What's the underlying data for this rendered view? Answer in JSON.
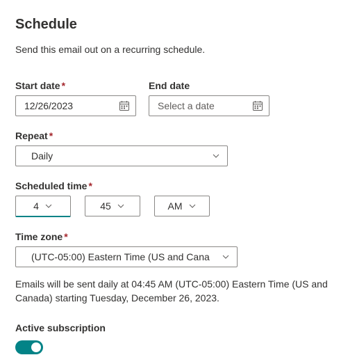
{
  "title": "Schedule",
  "description": "Send this email out on a recurring schedule.",
  "startDate": {
    "label": "Start date",
    "required": true,
    "value": "12/26/2023"
  },
  "endDate": {
    "label": "End date",
    "required": false,
    "placeholder": "Select a date",
    "value": ""
  },
  "repeat": {
    "label": "Repeat",
    "required": true,
    "value": "Daily"
  },
  "scheduledTime": {
    "label": "Scheduled time",
    "required": true,
    "hour": "4",
    "minute": "45",
    "ampm": "AM"
  },
  "timezone": {
    "label": "Time zone",
    "required": true,
    "value": "(UTC-05:00) Eastern Time (US and Cana"
  },
  "summary": "Emails will be sent daily at 04:45 AM (UTC-05:00) Eastern Time (US and Canada) starting Tuesday, December 26, 2023.",
  "subscription": {
    "label": "Active subscription",
    "active": true
  },
  "asterisk": "*"
}
